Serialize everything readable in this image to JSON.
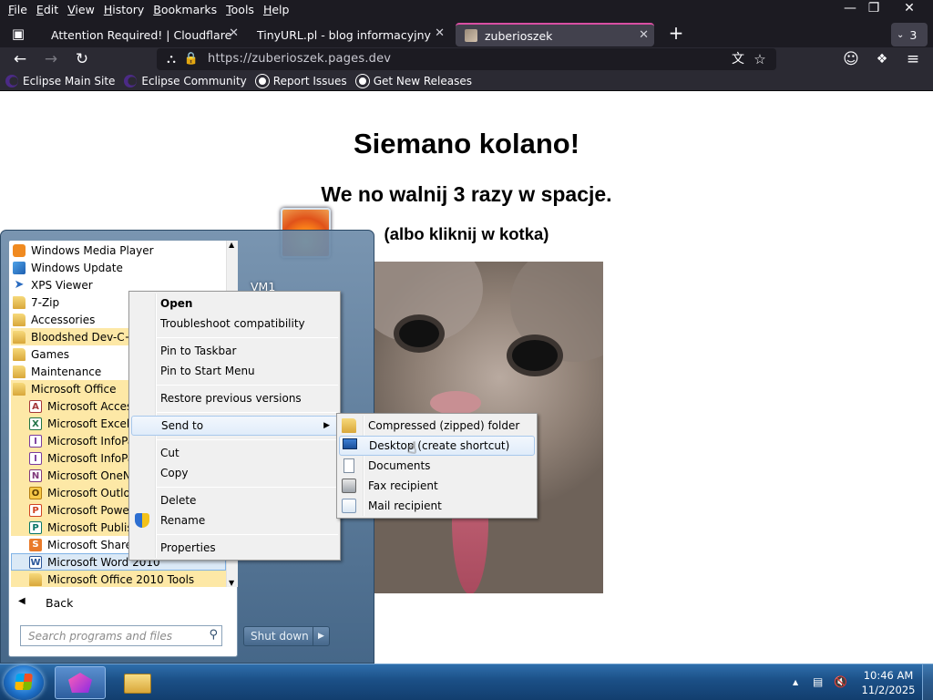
{
  "browser": {
    "menu": [
      "File",
      "Edit",
      "View",
      "History",
      "Bookmarks",
      "Tools",
      "Help"
    ],
    "tabs": [
      {
        "title": "Attention Required! | Cloudflare"
      },
      {
        "title": "TinyURL.pl - blog informacyjny"
      },
      {
        "title": "zuberioszek"
      }
    ],
    "tab_count": "3",
    "url": "https://zuberioszek.pages.dev",
    "bookmarks": [
      "Eclipse Main Site",
      "Eclipse Community",
      "Report Issues",
      "Get New Releases"
    ]
  },
  "page": {
    "heading": "Siemano kolano!",
    "subheading": "We no walnij 3 razy w spacje.",
    "hint": "(albo kliknij w kotka)"
  },
  "start_menu": {
    "programs": [
      {
        "label": "Windows Media Player",
        "icon": "media-player-icon"
      },
      {
        "label": "Windows Update",
        "icon": "windows-update-icon"
      },
      {
        "label": "XPS Viewer",
        "icon": "xps-viewer-icon"
      },
      {
        "label": "7-Zip",
        "icon": "folder-icon"
      },
      {
        "label": "Accessories",
        "icon": "folder-icon"
      },
      {
        "label": "Bloodshed Dev-C++",
        "icon": "folder-icon"
      },
      {
        "label": "Games",
        "icon": "folder-icon"
      },
      {
        "label": "Maintenance",
        "icon": "folder-icon"
      },
      {
        "label": "Microsoft Office",
        "icon": "folder-icon"
      },
      {
        "label": "Microsoft Access 2010",
        "icon": "access-icon"
      },
      {
        "label": "Microsoft Excel 2010",
        "icon": "excel-icon"
      },
      {
        "label": "Microsoft InfoPath Designer 2010",
        "icon": "infopath-icon"
      },
      {
        "label": "Microsoft InfoPath Filler 2010",
        "icon": "infopath-icon"
      },
      {
        "label": "Microsoft OneNote 2010",
        "icon": "onenote-icon"
      },
      {
        "label": "Microsoft Outlook 2010",
        "icon": "outlook-icon"
      },
      {
        "label": "Microsoft PowerPoint 2010",
        "icon": "powerpoint-icon"
      },
      {
        "label": "Microsoft Publisher 2010",
        "icon": "publisher-icon"
      },
      {
        "label": "Microsoft SharePoint Workspace 2010",
        "icon": "sharepoint-icon"
      },
      {
        "label": "Microsoft Word 2010",
        "icon": "word-icon"
      },
      {
        "label": "Microsoft Office 2010 Tools",
        "icon": "folder-icon"
      }
    ],
    "back_label": "Back",
    "search_placeholder": "Search programs and files",
    "user_label": "VM1",
    "shutdown_label": "Shut down"
  },
  "context_menu": {
    "items": [
      "Open",
      "Troubleshoot compatibility",
      "Pin to Taskbar",
      "Pin to Start Menu",
      "Restore previous versions",
      "Send to",
      "Cut",
      "Copy",
      "Delete",
      "Rename",
      "Properties"
    ]
  },
  "send_to_menu": {
    "items": [
      {
        "label": "Compressed (zipped) folder",
        "icon": "zip-folder-icon"
      },
      {
        "label": "Desktop (create shortcut)",
        "icon": "desktop-icon"
      },
      {
        "label": "Documents",
        "icon": "documents-icon"
      },
      {
        "label": "Fax recipient",
        "icon": "fax-icon"
      },
      {
        "label": "Mail recipient",
        "icon": "mail-icon"
      }
    ]
  },
  "taskbar": {
    "time": "10:46 AM",
    "date": "11/2/2025"
  }
}
